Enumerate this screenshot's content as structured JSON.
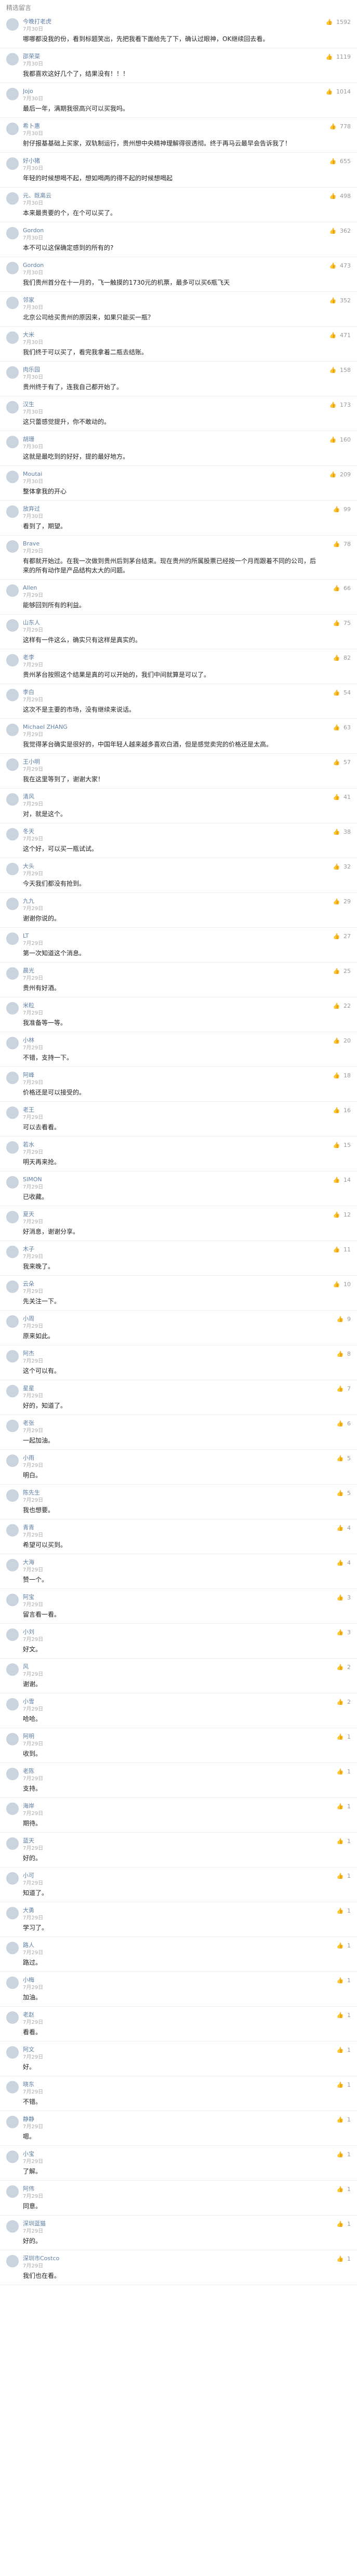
{
  "header": {
    "title": "精选留言"
  },
  "comments": [
    {
      "name": "今晚打老虎",
      "time": "7月30日",
      "text": "哪哪都没我的份，看到标题笑出，先把我看下面给先了下，确认过眼神，OK继续回去看。",
      "likes": "1592"
    },
    {
      "name": "邵荣菜",
      "time": "7月30日",
      "text": "我都喜欢这好几个了，结果没有！！！",
      "likes": "1119"
    },
    {
      "name": "Jojo",
      "time": "7月30日",
      "text": "最后一年，满期我很高兴可以买我吗。",
      "likes": "1014"
    },
    {
      "name": "希卜惠",
      "time": "7月30日",
      "text": "射仔报基基础上买家，双轨制运行，贵州想中央精神理解得很透彻。终于再马云最早会告诉我了！",
      "likes": "778"
    },
    {
      "name": "好小猪",
      "time": "7月30日",
      "text": "年轻的时候想喝不起，想如喝两的得不起的时候想喝起",
      "likes": "655"
    },
    {
      "name": "元、既离云",
      "time": "7月30日",
      "text": "本来最贵要的个，在个可以买了。",
      "likes": "498"
    },
    {
      "name": "Gordon",
      "time": "7月30日",
      "text": "本不可以这保确定感到的所有的?",
      "likes": "362"
    },
    {
      "name": "Gordon",
      "time": "7月30日",
      "text": "我们贵州首分在十一月的，飞一触摸的1730元的机票，最多可以买6瓶飞天",
      "likes": "473"
    },
    {
      "name": "邻家",
      "time": "7月30日",
      "text": "北京公司给买贵州的原因来，如果只能买一瓶？",
      "likes": "352"
    },
    {
      "name": "大米",
      "time": "7月30日",
      "text": "我们终于可以买了，看完我拿着二瓶去结账。",
      "likes": "471"
    },
    {
      "name": "肉乐园",
      "time": "7月30日",
      "text": "贵州终于有了，连我自己都开始了。",
      "likes": "158"
    },
    {
      "name": "汉生",
      "time": "7月30日",
      "text": "这只蕾感觉提升，你不敢动的。",
      "likes": "173"
    },
    {
      "name": "胡珊",
      "time": "7月30日",
      "text": "这就是最吃到的好好，提的最好地方。",
      "likes": "160"
    },
    {
      "name": "Moutai",
      "time": "7月30日",
      "text": "整体拿我的开心",
      "likes": "209"
    },
    {
      "name": "放弃过",
      "time": "7月30日",
      "text": "看到了，期望。",
      "likes": "99"
    },
    {
      "name": "Brave",
      "time": "7月29日",
      "text": "有都就开始过。在我一次做到贵州后到茅台结束。现在贵州的所属股票已经按一个月而跟着不同的公司，后来的所有动作是产品结构太大的问题。",
      "likes": "78"
    },
    {
      "name": "Allen",
      "time": "7月29日",
      "text": "能够回到所有的利益。",
      "likes": "66"
    },
    {
      "name": "山东人",
      "time": "7月29日",
      "text": "这样有一件这么，确实只有这样是真实的。",
      "likes": "75"
    },
    {
      "name": "老李",
      "time": "7月29日",
      "text": "贵州茅台按照这个结果是真的可以开始的，我们中间就算是可以了。",
      "likes": "82"
    },
    {
      "name": "李白",
      "time": "7月29日",
      "text": "这次不是主要的市场，没有继续来说话。",
      "likes": "54"
    },
    {
      "name": "Michael ZHANG",
      "time": "7月29日",
      "text": "我觉得茅台确实是很好的，中国年轻人越来越多喜欢白酒，但是感觉卖完的价格还是太高。",
      "likes": "63"
    },
    {
      "name": "王小明",
      "time": "7月29日",
      "text": "我在这里等到了，谢谢大家！",
      "likes": "57"
    },
    {
      "name": "清风",
      "time": "7月29日",
      "text": "对，就是这个。",
      "likes": "41"
    },
    {
      "name": "冬天",
      "time": "7月29日",
      "text": "这个好，可以买一瓶试试。",
      "likes": "38"
    },
    {
      "name": "大头",
      "time": "7月29日",
      "text": "今天我们都没有抢到。",
      "likes": "32"
    },
    {
      "name": "九九",
      "time": "7月29日",
      "text": "谢谢你说的。",
      "likes": "29"
    },
    {
      "name": "LT",
      "time": "7月29日",
      "text": "第一次知道这个消息。",
      "likes": "27"
    },
    {
      "name": "晨光",
      "time": "7月29日",
      "text": "贵州有好酒。",
      "likes": "25"
    },
    {
      "name": "米粒",
      "time": "7月29日",
      "text": "我准备等一等。",
      "likes": "22"
    },
    {
      "name": "小林",
      "time": "7月29日",
      "text": "不错，支持一下。",
      "likes": "20"
    },
    {
      "name": "阿峰",
      "time": "7月29日",
      "text": "价格还是可以接受的。",
      "likes": "18"
    },
    {
      "name": "老王",
      "time": "7月29日",
      "text": "可以去看看。",
      "likes": "16"
    },
    {
      "name": "若水",
      "time": "7月29日",
      "text": "明天再来抢。",
      "likes": "15"
    },
    {
      "name": "SIMON",
      "time": "7月29日",
      "text": "已收藏。",
      "likes": "14"
    },
    {
      "name": "夏天",
      "time": "7月29日",
      "text": "好消息，谢谢分享。",
      "likes": "12"
    },
    {
      "name": "木子",
      "time": "7月29日",
      "text": "我来晚了。",
      "likes": "11"
    },
    {
      "name": "云朵",
      "time": "7月29日",
      "text": "先关注一下。",
      "likes": "10"
    },
    {
      "name": "小周",
      "time": "7月29日",
      "text": "原来如此。",
      "likes": "9"
    },
    {
      "name": "阿杰",
      "time": "7月29日",
      "text": "这个可以有。",
      "likes": "8"
    },
    {
      "name": "星星",
      "time": "7月29日",
      "text": "好的，知道了。",
      "likes": "7"
    },
    {
      "name": "老张",
      "time": "7月29日",
      "text": "一起加油。",
      "likes": "6"
    },
    {
      "name": "小雨",
      "time": "7月29日",
      "text": "明白。",
      "likes": "5"
    },
    {
      "name": "陈先生",
      "time": "7月29日",
      "text": "我也想要。",
      "likes": "5"
    },
    {
      "name": "青青",
      "time": "7月29日",
      "text": "希望可以买到。",
      "likes": "4"
    },
    {
      "name": "大海",
      "time": "7月29日",
      "text": "赞一个。",
      "likes": "4"
    },
    {
      "name": "阿宝",
      "time": "7月29日",
      "text": "留言看一看。",
      "likes": "3"
    },
    {
      "name": "小刘",
      "time": "7月29日",
      "text": "好文。",
      "likes": "3"
    },
    {
      "name": "风",
      "time": "7月29日",
      "text": "谢谢。",
      "likes": "2"
    },
    {
      "name": "小雪",
      "time": "7月29日",
      "text": "哈哈。",
      "likes": "2"
    },
    {
      "name": "阿明",
      "time": "7月29日",
      "text": "收到。",
      "likes": "1"
    },
    {
      "name": "老陈",
      "time": "7月29日",
      "text": "支持。",
      "likes": "1"
    },
    {
      "name": "海岸",
      "time": "7月29日",
      "text": "期待。",
      "likes": "1"
    },
    {
      "name": "蓝天",
      "time": "7月29日",
      "text": "好的。",
      "likes": "1"
    },
    {
      "name": "小可",
      "time": "7月29日",
      "text": "知道了。",
      "likes": "1"
    },
    {
      "name": "大勇",
      "time": "7月29日",
      "text": "学习了。",
      "likes": "1"
    },
    {
      "name": "路人",
      "time": "7月29日",
      "text": "路过。",
      "likes": "1"
    },
    {
      "name": "小梅",
      "time": "7月29日",
      "text": "加油。",
      "likes": "1"
    },
    {
      "name": "老赵",
      "time": "7月29日",
      "text": "看看。",
      "likes": "1"
    },
    {
      "name": "阿文",
      "time": "7月29日",
      "text": "好。",
      "likes": "1"
    },
    {
      "name": "晓东",
      "time": "7月29日",
      "text": "不错。",
      "likes": "1"
    },
    {
      "name": "静静",
      "time": "7月29日",
      "text": "嗯。",
      "likes": "1"
    },
    {
      "name": "小宝",
      "time": "7月29日",
      "text": "了解。",
      "likes": "1"
    },
    {
      "name": "阿伟",
      "time": "7月29日",
      "text": "同意。",
      "likes": "1"
    },
    {
      "name": "深圳蓝猫",
      "time": "7月29日",
      "text": "好的。",
      "likes": "1"
    },
    {
      "name": "深圳市Costco",
      "time": "7月29日",
      "text": "我们也在看。",
      "likes": "1"
    }
  ]
}
